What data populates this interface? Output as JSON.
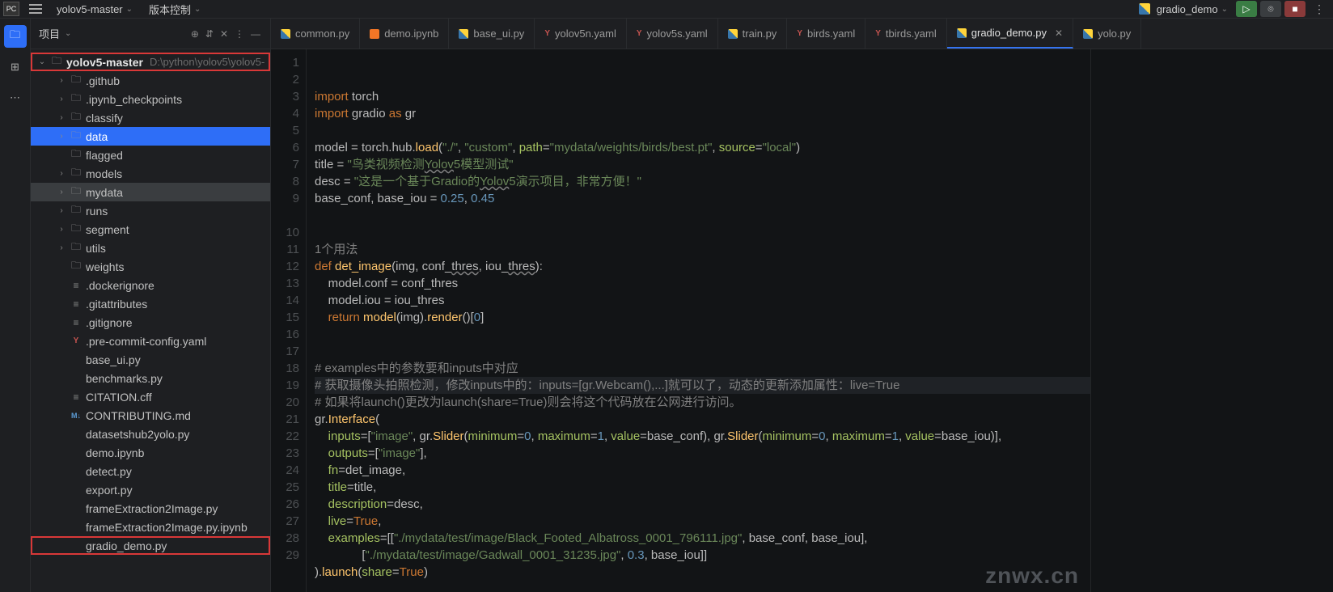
{
  "topbar": {
    "project_drop": "yolov5-master",
    "vc_drop": "版本控制",
    "run_config": "gradio_demo"
  },
  "project_panel": {
    "title": "项目",
    "root": {
      "name": "yolov5-master",
      "path": "D:\\python\\yolov5\\yolov5-"
    },
    "tree": [
      {
        "indent": 1,
        "chev": ">",
        "ico": "folder",
        "label": ".github"
      },
      {
        "indent": 1,
        "chev": ">",
        "ico": "folder",
        "label": ".ipynb_checkpoints"
      },
      {
        "indent": 1,
        "chev": ">",
        "ico": "folder",
        "label": "classify"
      },
      {
        "indent": 1,
        "chev": ">",
        "ico": "folder",
        "label": "data",
        "sel": true
      },
      {
        "indent": 1,
        "chev": "",
        "ico": "folder",
        "label": "flagged"
      },
      {
        "indent": 1,
        "chev": ">",
        "ico": "folder",
        "label": "models"
      },
      {
        "indent": 1,
        "chev": ">",
        "ico": "folder",
        "label": "mydata",
        "hl": true
      },
      {
        "indent": 1,
        "chev": ">",
        "ico": "folder",
        "label": "runs"
      },
      {
        "indent": 1,
        "chev": ">",
        "ico": "folder",
        "label": "segment"
      },
      {
        "indent": 1,
        "chev": ">",
        "ico": "folder",
        "label": "utils"
      },
      {
        "indent": 1,
        "chev": "",
        "ico": "folder",
        "label": "weights"
      },
      {
        "indent": 1,
        "chev": "",
        "ico": "txt",
        "label": ".dockerignore"
      },
      {
        "indent": 1,
        "chev": "",
        "ico": "txt",
        "label": ".gitattributes"
      },
      {
        "indent": 1,
        "chev": "",
        "ico": "txt",
        "label": ".gitignore"
      },
      {
        "indent": 1,
        "chev": "",
        "ico": "yaml",
        "label": ".pre-commit-config.yaml"
      },
      {
        "indent": 1,
        "chev": "",
        "ico": "py",
        "label": "base_ui.py"
      },
      {
        "indent": 1,
        "chev": "",
        "ico": "py",
        "label": "benchmarks.py"
      },
      {
        "indent": 1,
        "chev": "",
        "ico": "txt",
        "label": "CITATION.cff"
      },
      {
        "indent": 1,
        "chev": "",
        "ico": "md",
        "label": "CONTRIBUTING.md"
      },
      {
        "indent": 1,
        "chev": "",
        "ico": "py",
        "label": "datasetshub2yolo.py"
      },
      {
        "indent": 1,
        "chev": "",
        "ico": "jup",
        "label": "demo.ipynb"
      },
      {
        "indent": 1,
        "chev": "",
        "ico": "py",
        "label": "detect.py"
      },
      {
        "indent": 1,
        "chev": "",
        "ico": "py",
        "label": "export.py"
      },
      {
        "indent": 1,
        "chev": "",
        "ico": "py",
        "label": "frameExtraction2Image.py"
      },
      {
        "indent": 1,
        "chev": "",
        "ico": "jup",
        "label": "frameExtraction2Image.py.ipynb"
      },
      {
        "indent": 1,
        "chev": "",
        "ico": "py",
        "label": "gradio_demo.py",
        "mark": true
      }
    ]
  },
  "tabs": [
    {
      "ico": "py",
      "label": "common.py"
    },
    {
      "ico": "jup",
      "label": "demo.ipynb"
    },
    {
      "ico": "py",
      "label": "base_ui.py"
    },
    {
      "ico": "yaml",
      "label": "yolov5n.yaml"
    },
    {
      "ico": "yaml",
      "label": "yolov5s.yaml"
    },
    {
      "ico": "py",
      "label": "train.py"
    },
    {
      "ico": "yaml",
      "label": "birds.yaml"
    },
    {
      "ico": "yaml",
      "label": "tbirds.yaml"
    },
    {
      "ico": "py",
      "label": "gradio_demo.py",
      "act": true,
      "close": true
    },
    {
      "ico": "py",
      "label": "yolo.py"
    }
  ],
  "code": {
    "lines": [
      {
        "n": 1,
        "h": "<span class='kw'>import</span> torch"
      },
      {
        "n": 2,
        "h": "<span class='kw'>import</span> gradio <span class='kw'>as</span> gr"
      },
      {
        "n": 3,
        "h": ""
      },
      {
        "n": 4,
        "h": "model = torch.hub.<span class='fn'>load</span>(<span class='str'>\"./\"</span>, <span class='str'>\"custom\"</span>, <span class='par'>path</span>=<span class='str'>\"mydata/weights/birds/best.pt\"</span>, <span class='par'>source</span>=<span class='str'>\"local\"</span>)"
      },
      {
        "n": 5,
        "h": "title = <span class='str'>\"鸟类视频检测<span class='under'>Yolov</span>5模型测试\"</span>"
      },
      {
        "n": 6,
        "h": "desc = <span class='str'>\"这是一个基于Gradio的<span class='under'>Yolov</span>5演示项目，非常方便！\"</span>"
      },
      {
        "n": 7,
        "h": "base_conf, base_iou = <span class='num'>0.25</span>, <span class='num'>0.45</span>"
      },
      {
        "n": 8,
        "h": ""
      },
      {
        "n": 9,
        "h": ""
      },
      {
        "n": "",
        "h": "<span class='cmt'>1个用法</span>"
      },
      {
        "n": 10,
        "h": "<span class='kw'>def</span> <span class='fn'>det_image</span>(img, conf_<span class='under'>thres</span>, iou_<span class='under'>thres</span>):"
      },
      {
        "n": 11,
        "h": "    model.conf = conf_thres"
      },
      {
        "n": 12,
        "h": "    model.iou = iou_thres"
      },
      {
        "n": 13,
        "h": "    <span class='kw'>return</span> <span class='fn'>model</span>(img).<span class='fn'>render</span>()[<span class='num'>0</span>]"
      },
      {
        "n": 14,
        "h": ""
      },
      {
        "n": 15,
        "h": ""
      },
      {
        "n": 16,
        "h": "<span class='cmt'># examples中的参数要和inputs中对应</span>"
      },
      {
        "n": 17,
        "h": "<span class='cmt'># 获取摄像头拍照检测，修改inputs中的：inputs=[gr.Webcam(),...]就可以了，动态的更新添加属性：live=True</span>",
        "hl": true
      },
      {
        "n": 18,
        "h": "<span class='cmt'># 如果将launch()更改为launch(share=True)则会将这个代码放在公网进行访问。</span>"
      },
      {
        "n": 19,
        "h": "gr.<span class='fn'>Interface</span>("
      },
      {
        "n": 20,
        "h": "    <span class='par'>inputs</span>=[<span class='str'>\"image\"</span>, gr.<span class='fn'>Slider</span>(<span class='par'>minimum</span>=<span class='num'>0</span>, <span class='par'>maximum</span>=<span class='num'>1</span>, <span class='par'>value</span>=base_conf), gr.<span class='fn'>Slider</span>(<span class='par'>minimum</span>=<span class='num'>0</span>, <span class='par'>maximum</span>=<span class='num'>1</span>, <span class='par'>value</span>=base_iou)],"
      },
      {
        "n": 21,
        "h": "    <span class='par'>outputs</span>=[<span class='str'>\"image\"</span>],"
      },
      {
        "n": 22,
        "h": "    <span class='par'>fn</span>=det_image,"
      },
      {
        "n": 23,
        "h": "    <span class='par'>title</span>=title,"
      },
      {
        "n": 24,
        "h": "    <span class='par'>description</span>=desc,"
      },
      {
        "n": 25,
        "h": "    <span class='par'>live</span>=<span class='kw'>True</span>,"
      },
      {
        "n": 26,
        "h": "    <span class='par'>examples</span>=[[<span class='str'>\"./mydata/test/image/Black_Footed_Albatross_0001_796111.jpg\"</span>, base_conf, base_iou],"
      },
      {
        "n": 27,
        "h": "              [<span class='str'>\"./mydata/test/image/Gadwall_0001_31235.jpg\"</span>, <span class='num'>0.3</span>, base_iou]]"
      },
      {
        "n": 28,
        "h": ").<span class='fn'>launch</span>(<span class='par'>share</span>=<span class='kw'>True</span>)"
      },
      {
        "n": 29,
        "h": ""
      }
    ]
  },
  "watermark": "znwx.cn"
}
